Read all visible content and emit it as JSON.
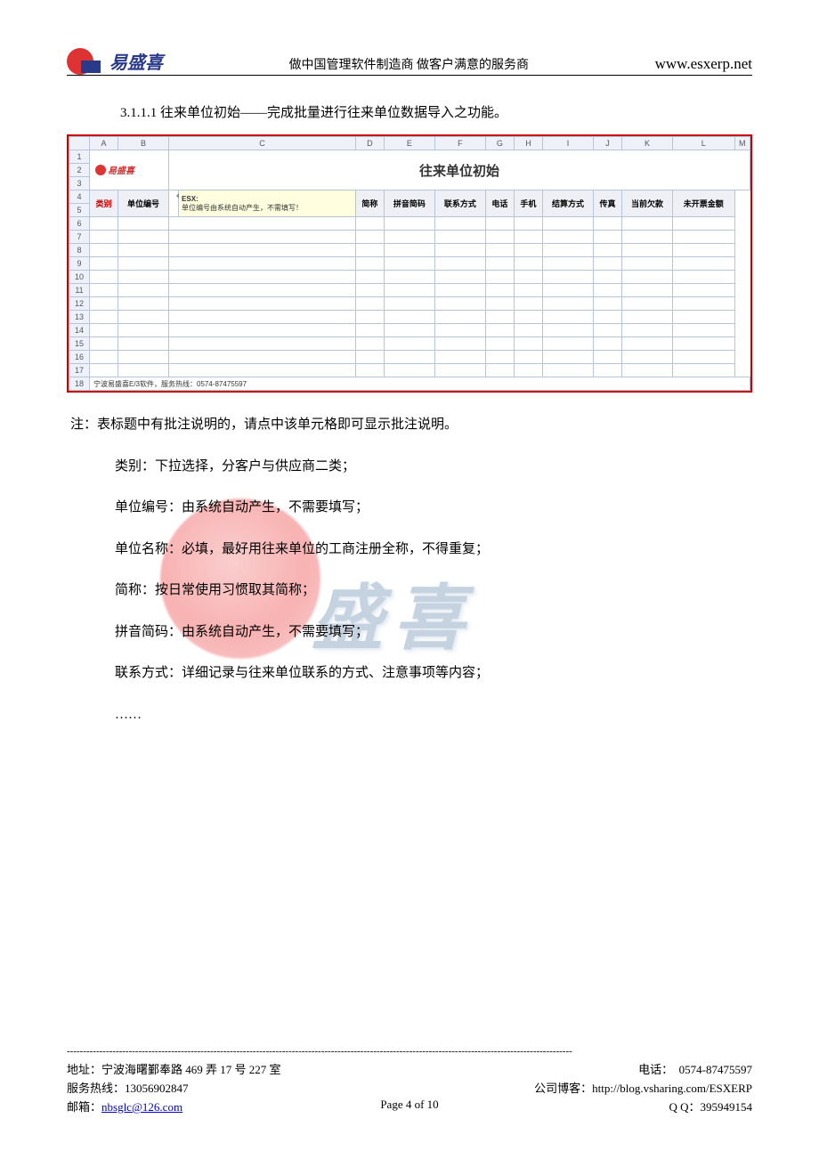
{
  "header": {
    "brand_text": "易盛喜",
    "tagline": "做中国管理软件制造商  做客户满意的服务商",
    "website": "www.esxerp.net"
  },
  "section": {
    "number": "3.1.1.1",
    "title": "往来单位初始——完成批量进行往来单位数据导入之功能。"
  },
  "spreadsheet": {
    "title": "往来单位初始",
    "col_letters": [
      "A",
      "B",
      "C",
      "D",
      "E",
      "F",
      "G",
      "H",
      "I",
      "J",
      "K",
      "L",
      "M"
    ],
    "row_numbers": [
      "1",
      "2",
      "3",
      "4",
      "5",
      "6",
      "7",
      "8",
      "9",
      "10",
      "11",
      "12",
      "13",
      "14",
      "15",
      "16",
      "17",
      "18"
    ],
    "comment": {
      "author": "ESX:",
      "text": "单位编号由系统自动产生，不需填写！"
    },
    "headers": [
      "类别",
      "单位编号",
      "",
      "简称",
      "拼音简码",
      "联系方式",
      "电话",
      "手机",
      "结算方式",
      "传真",
      "当前欠款",
      "未开票金额"
    ],
    "footer_text": "宁波易盛喜E/3软件，服务热线：0574-87475597",
    "mini_brand": "易盛喜"
  },
  "body": {
    "note": "注：表标题中有批注说明的，请点中该单元格即可显示批注说明。",
    "items": [
      "类别：下拉选择，分客户与供应商二类；",
      "单位编号：由系统自动产生，不需要填写；",
      "单位名称：必填，最好用往来单位的工商注册全称，不得重复；",
      "简称：按日常使用习惯取其简称；",
      "拼音简码：由系统自动产生，不需要填写；",
      "联系方式：详细记录与往来单位联系的方式、注意事项等内容；",
      "……"
    ]
  },
  "watermark_text": "盛喜",
  "footer": {
    "rule": "-----------------------------------------------------------------------------------------------------------------------------------------------------------",
    "address_label": "地址：",
    "address": "宁波海曙鄞奉路 469 弄 17 号 227 室",
    "phone_label": "电话：",
    "phone": "0574-87475597",
    "hotline_label": "服务热线：",
    "hotline": "13056902847",
    "blog_label": "公司博客：",
    "blog": "http://blog.vsharing.com/ESXERP",
    "email_label": "邮箱：",
    "email": "nbsglc@126.com",
    "qq_label": "Q Q：",
    "qq": "395949154",
    "page_indicator": "Page 4 of 10"
  }
}
